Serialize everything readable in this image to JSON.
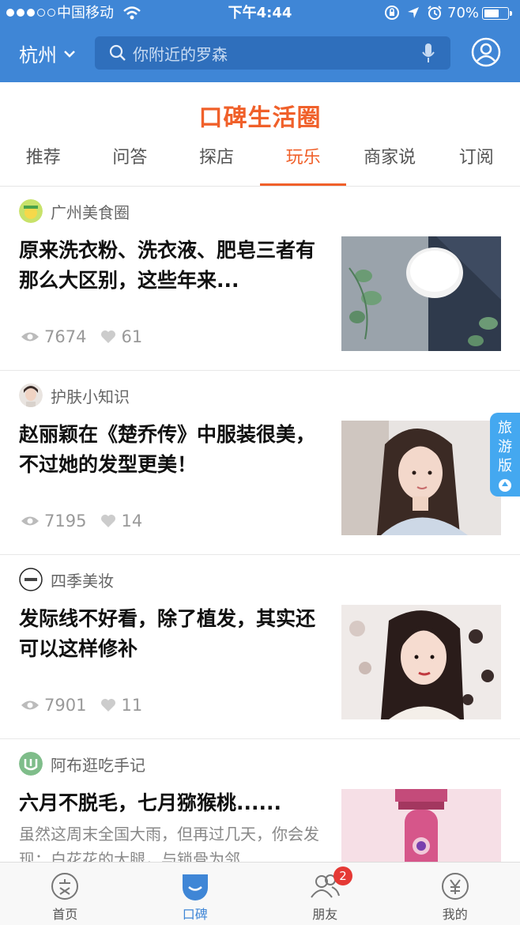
{
  "status_bar": {
    "carrier": "中国移动",
    "time": "下午4:44",
    "battery": "70%",
    "battery_level": 0.7,
    "icons": [
      "signal-dots",
      "wifi-icon",
      "rotation-lock-icon",
      "location-arrow-icon",
      "alarm-icon",
      "battery-icon"
    ]
  },
  "header": {
    "city": "杭州",
    "search_placeholder": "你附近的罗森",
    "color": "#3f86d6"
  },
  "brand": {
    "title": "口碑生活圈",
    "color": "#f0602a"
  },
  "tabs": [
    {
      "label": "推荐",
      "active": false
    },
    {
      "label": "问答",
      "active": false
    },
    {
      "label": "探店",
      "active": false
    },
    {
      "label": "玩乐",
      "active": true
    },
    {
      "label": "商家说",
      "active": false
    },
    {
      "label": "订阅",
      "active": false
    }
  ],
  "feed": [
    {
      "source": "广州美食圈",
      "title": "原来洗衣粉、洗衣液、肥皂三者有那么大区别，这些年来...",
      "views": "7674",
      "likes": "61",
      "thumb": "bowl-of-powder-image"
    },
    {
      "source": "护肤小知识",
      "title": "赵丽颖在《楚乔传》中服装很美，不过她的发型更美！",
      "views": "7195",
      "likes": "14",
      "thumb": "woman-portrait-image"
    },
    {
      "source": "四季美妆",
      "title": "发际线不好看，除了植发，其实还可以这样修补",
      "views": "7901",
      "likes": "11",
      "thumb": "woman-portrait-image"
    },
    {
      "source": "阿布逛吃手记",
      "title": "六月不脱毛，七月猕猴桃......",
      "excerpt": "虽然这周末全国大雨，但再过几天，你会发现：白花花的大腿，与锁骨为邻...",
      "thumb": "epilator-image"
    }
  ],
  "travel_badge": "旅游版",
  "bottom_nav": [
    {
      "label": "首页",
      "icon": "home-friend-icon",
      "active": false
    },
    {
      "label": "口碑",
      "icon": "koubei-icon",
      "active": true
    },
    {
      "label": "朋友",
      "icon": "friends-icon",
      "active": false,
      "badge": "2"
    },
    {
      "label": "我的",
      "icon": "yuan-icon",
      "active": false
    }
  ]
}
